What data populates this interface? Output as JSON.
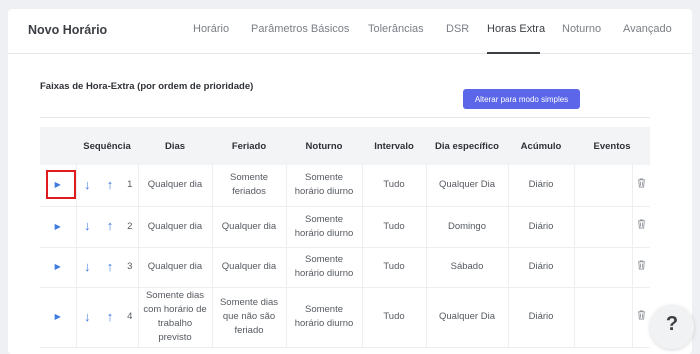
{
  "header": {
    "title": "Novo Horário",
    "tabs": [
      {
        "label": "Horário"
      },
      {
        "label": "Parâmetros Básicos"
      },
      {
        "label": "Tolerâncias"
      },
      {
        "label": "DSR"
      },
      {
        "label": "Horas Extra",
        "active": true
      },
      {
        "label": "Noturno"
      },
      {
        "label": "Avançado"
      }
    ]
  },
  "section": {
    "title": "Faixas de Hora-Extra (por ordem de prioridade)",
    "simple_mode_button": "Alterar para modo simples"
  },
  "table": {
    "columns": [
      "Sequência",
      "Dias",
      "Feriado",
      "Noturno",
      "Intervalo",
      "Dia específico",
      "Acúmulo",
      "Eventos"
    ],
    "rows": [
      {
        "seq": "1",
        "dias": "Qualquer dia",
        "feriado": "Somente feriados",
        "noturno": "Somente horário diurno",
        "intervalo": "Tudo",
        "dia_especifico": "Qualquer Dia",
        "acumulo": "Diário",
        "eventos": ""
      },
      {
        "seq": "2",
        "dias": "Qualquer dia",
        "feriado": "Qualquer dia",
        "noturno": "Somente horário diurno",
        "intervalo": "Tudo",
        "dia_especifico": "Domingo",
        "acumulo": "Diário",
        "eventos": ""
      },
      {
        "seq": "3",
        "dias": "Qualquer dia",
        "feriado": "Qualquer dia",
        "noturno": "Somente horário diurno",
        "intervalo": "Tudo",
        "dia_especifico": "Sábado",
        "acumulo": "Diário",
        "eventos": ""
      },
      {
        "seq": "4",
        "dias": "Somente dias com horário de trabalho previsto",
        "feriado": "Somente dias que não são feriado",
        "noturno": "Somente horário diurno",
        "intervalo": "Tudo",
        "dia_especifico": "Qualquer Dia",
        "acumulo": "Diário",
        "eventos": ""
      }
    ]
  },
  "help_button": "?",
  "colors": {
    "accent": "#5b66e8",
    "icon_blue": "#3d7be0",
    "highlight": "#e01b1b"
  }
}
